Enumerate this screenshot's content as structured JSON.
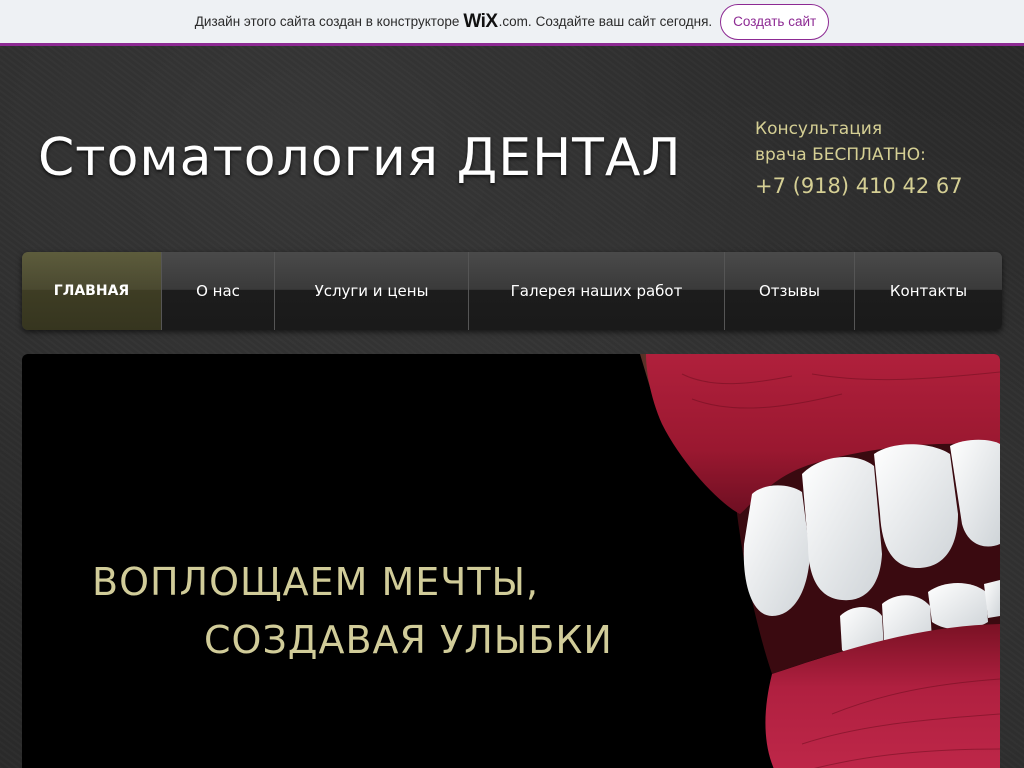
{
  "wix_banner": {
    "text_before": "Дизайн этого сайта создан в конструкторе",
    "logo": "WiX",
    "logo_suffix": ".com.",
    "text_after": "Создайте ваш сайт сегодня.",
    "cta_label": "Создать сайт",
    "accent_color": "#8d2a93"
  },
  "header": {
    "title": "Стоматология ДЕНТАЛ",
    "consult_line1": "Консультация",
    "consult_line2": "врача БЕСПЛАТНО:",
    "phone": "+7 (918) 410 42 67",
    "accent_color": "#d5cf94"
  },
  "nav": {
    "items": [
      {
        "label": "ГЛАВНАЯ",
        "active": true
      },
      {
        "label": "О нас"
      },
      {
        "label": "Услуги и цены"
      },
      {
        "label": "Галерея наших работ"
      },
      {
        "label": "Отзывы"
      },
      {
        "label": "Контакты"
      }
    ]
  },
  "hero": {
    "line1": "ВОПЛОЩАЕМ МЕЧТЫ,",
    "line2": "СОЗДАВАЯ УЛЫБКИ",
    "text_color": "#d1cc99",
    "image": "smiling-lips-teeth-photo"
  }
}
